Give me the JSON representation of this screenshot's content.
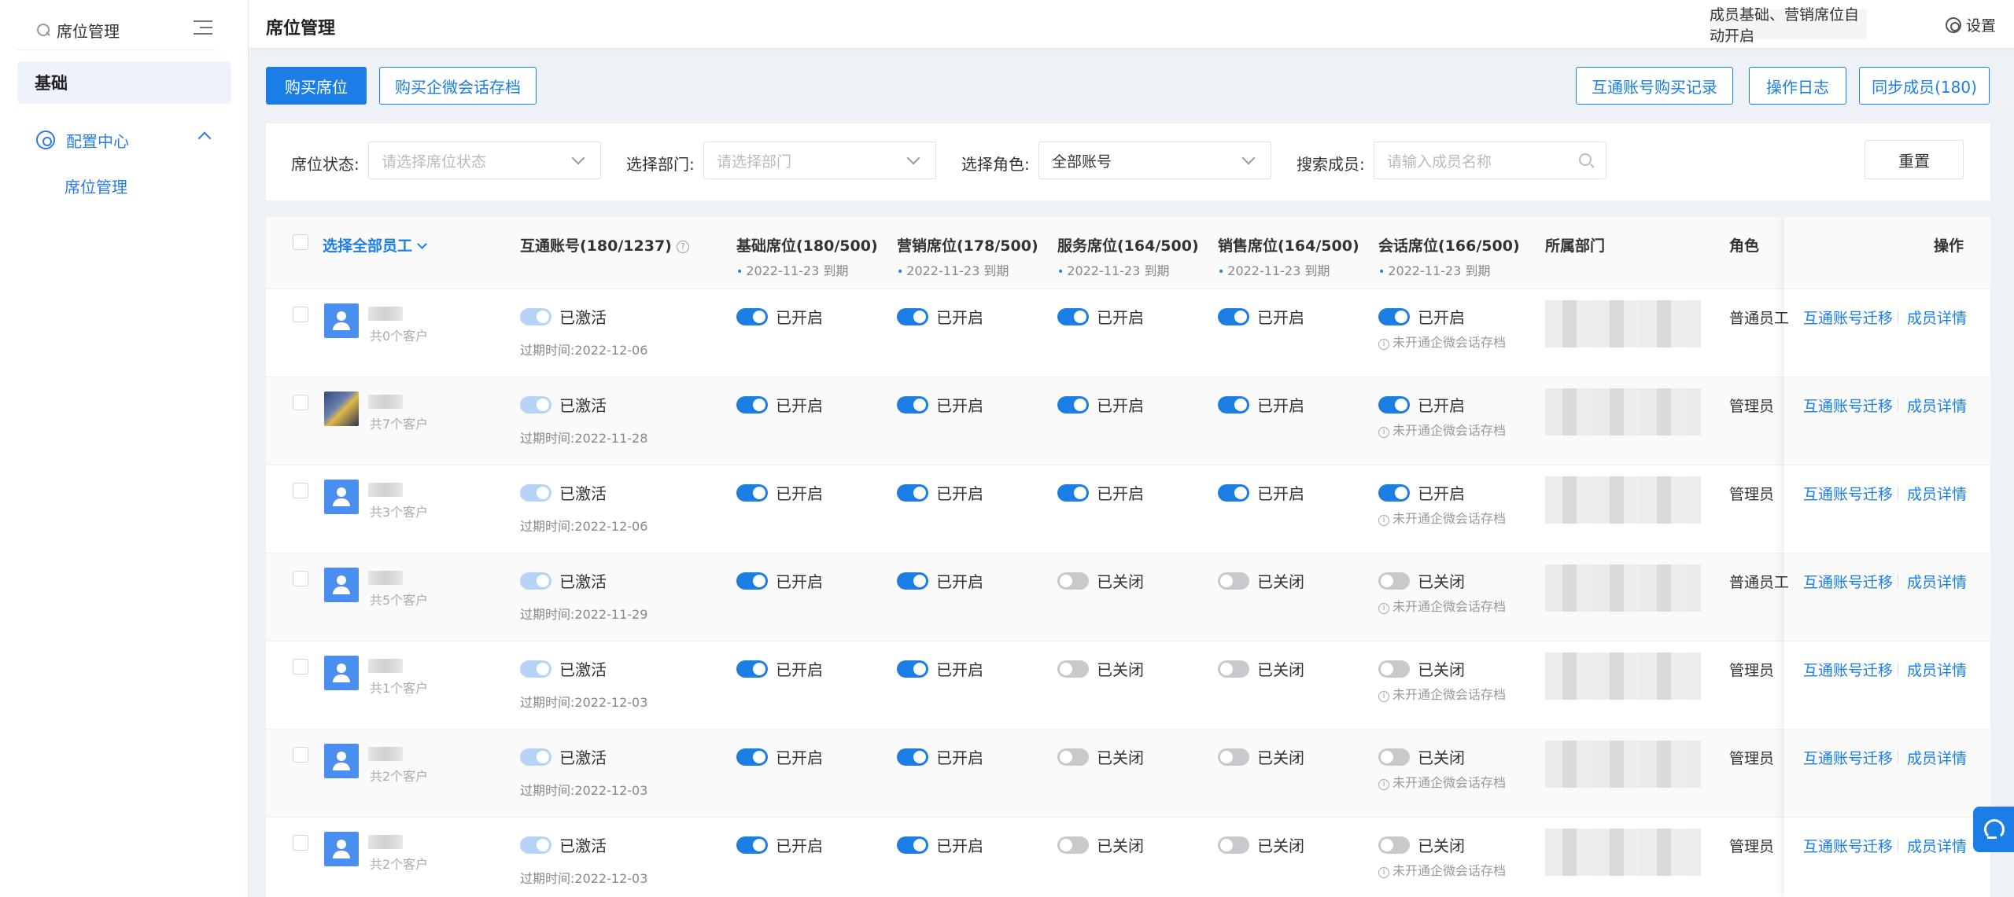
{
  "sidebar": {
    "search_value": "席位管理",
    "group_label": "基础",
    "nav_label": "配置中心",
    "sub_label": "席位管理"
  },
  "header": {
    "title": "席位管理",
    "notice": "成员基础、营销席位自动开启",
    "settings_label": "设置"
  },
  "toolbar": {
    "buy_seats": "购买席位",
    "buy_archive": "购买企微会话存档",
    "purchase_records": "互通账号购买记录",
    "op_log": "操作日志",
    "sync_members": "同步成员(180)"
  },
  "filters": {
    "seat_status_label": "席位状态:",
    "seat_status_placeholder": "请选择席位状态",
    "dept_label": "选择部门:",
    "dept_placeholder": "请选择部门",
    "role_label": "选择角色:",
    "role_value": "全部账号",
    "search_label": "搜索成员:",
    "search_placeholder": "请输入成员名称",
    "reset": "重置"
  },
  "table": {
    "headers": {
      "select_all": "选择全部员工",
      "interop": "互通账号(180/1237)",
      "basic": "基础席位(180/500)",
      "marketing": "营销席位(178/500)",
      "service": "服务席位(164/500)",
      "sales": "销售席位(164/500)",
      "chat": "会话席位(166/500)",
      "dept": "所属部门",
      "role": "角色",
      "ops": "操作",
      "expiry_note": "2022-11-23 到期"
    },
    "rows": [
      {
        "customers": "共0个客户",
        "interop": "已激活",
        "expire": "过期时间:2022-12-06",
        "basic": "已开启",
        "marketing": "已开启",
        "service": "已开启",
        "sales": "已开启",
        "chat": "已开启",
        "chat_note": "未开通企微会话存档",
        "role": "普通员工",
        "op1": "互通账号迁移",
        "op2": "成员详情"
      },
      {
        "customers": "共7个客户",
        "interop": "已激活",
        "expire": "过期时间:2022-11-28",
        "basic": "已开启",
        "marketing": "已开启",
        "service": "已开启",
        "sales": "已开启",
        "chat": "已开启",
        "chat_note": "未开通企微会话存档",
        "role": "管理员",
        "op1": "互通账号迁移",
        "op2": "成员详情"
      },
      {
        "customers": "共3个客户",
        "interop": "已激活",
        "expire": "过期时间:2022-12-06",
        "basic": "已开启",
        "marketing": "已开启",
        "service": "已开启",
        "sales": "已开启",
        "chat": "已开启",
        "chat_note": "未开通企微会话存档",
        "role": "管理员",
        "op1": "互通账号迁移",
        "op2": "成员详情"
      },
      {
        "customers": "共5个客户",
        "interop": "已激活",
        "expire": "过期时间:2022-11-29",
        "basic": "已开启",
        "marketing": "已开启",
        "service": "已关闭",
        "sales": "已关闭",
        "chat": "已关闭",
        "chat_note": "未开通企微会话存档",
        "role": "普通员工",
        "op1": "互通账号迁移",
        "op2": "成员详情"
      },
      {
        "customers": "共1个客户",
        "interop": "已激活",
        "expire": "过期时间:2022-12-03",
        "basic": "已开启",
        "marketing": "已开启",
        "service": "已关闭",
        "sales": "已关闭",
        "chat": "已关闭",
        "chat_note": "未开通企微会话存档",
        "role": "管理员",
        "op1": "互通账号迁移",
        "op2": "成员详情"
      },
      {
        "customers": "共2个客户",
        "interop": "已激活",
        "expire": "过期时间:2022-12-03",
        "basic": "已开启",
        "marketing": "已开启",
        "service": "已关闭",
        "sales": "已关闭",
        "chat": "已关闭",
        "chat_note": "未开通企微会话存档",
        "role": "管理员",
        "op1": "互通账号迁移",
        "op2": "成员详情"
      },
      {
        "customers": "共2个客户",
        "interop": "已激活",
        "expire": "过期时间:2022-12-03",
        "basic": "已开启",
        "marketing": "已开启",
        "service": "已关闭",
        "sales": "已关闭",
        "chat": "已关闭",
        "chat_note": "未开通企微会话存档",
        "role": "管理员",
        "op1": "互通账号迁移",
        "op2": "成员详情"
      }
    ]
  },
  "colors": {
    "accent": "#1a7ee6",
    "toggle_off": "#c7c9cc"
  }
}
